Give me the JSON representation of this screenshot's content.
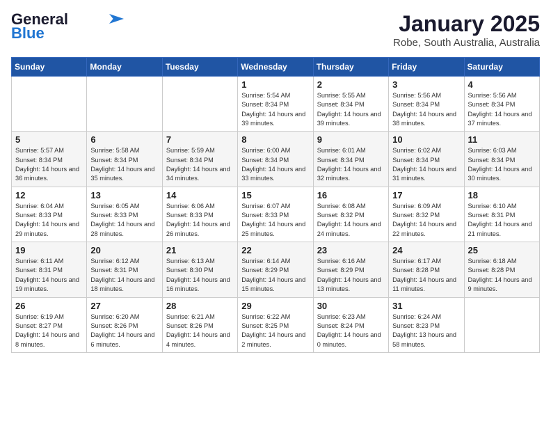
{
  "logo": {
    "line1": "General",
    "line2": "Blue"
  },
  "title": "January 2025",
  "subtitle": "Robe, South Australia, Australia",
  "days_of_week": [
    "Sunday",
    "Monday",
    "Tuesday",
    "Wednesday",
    "Thursday",
    "Friday",
    "Saturday"
  ],
  "weeks": [
    [
      null,
      null,
      null,
      {
        "day": 1,
        "sunrise": "5:54 AM",
        "sunset": "8:34 PM",
        "daylight": "14 hours and 39 minutes."
      },
      {
        "day": 2,
        "sunrise": "5:55 AM",
        "sunset": "8:34 PM",
        "daylight": "14 hours and 39 minutes."
      },
      {
        "day": 3,
        "sunrise": "5:56 AM",
        "sunset": "8:34 PM",
        "daylight": "14 hours and 38 minutes."
      },
      {
        "day": 4,
        "sunrise": "5:56 AM",
        "sunset": "8:34 PM",
        "daylight": "14 hours and 37 minutes."
      }
    ],
    [
      {
        "day": 5,
        "sunrise": "5:57 AM",
        "sunset": "8:34 PM",
        "daylight": "14 hours and 36 minutes."
      },
      {
        "day": 6,
        "sunrise": "5:58 AM",
        "sunset": "8:34 PM",
        "daylight": "14 hours and 35 minutes."
      },
      {
        "day": 7,
        "sunrise": "5:59 AM",
        "sunset": "8:34 PM",
        "daylight": "14 hours and 34 minutes."
      },
      {
        "day": 8,
        "sunrise": "6:00 AM",
        "sunset": "8:34 PM",
        "daylight": "14 hours and 33 minutes."
      },
      {
        "day": 9,
        "sunrise": "6:01 AM",
        "sunset": "8:34 PM",
        "daylight": "14 hours and 32 minutes."
      },
      {
        "day": 10,
        "sunrise": "6:02 AM",
        "sunset": "8:34 PM",
        "daylight": "14 hours and 31 minutes."
      },
      {
        "day": 11,
        "sunrise": "6:03 AM",
        "sunset": "8:34 PM",
        "daylight": "14 hours and 30 minutes."
      }
    ],
    [
      {
        "day": 12,
        "sunrise": "6:04 AM",
        "sunset": "8:33 PM",
        "daylight": "14 hours and 29 minutes."
      },
      {
        "day": 13,
        "sunrise": "6:05 AM",
        "sunset": "8:33 PM",
        "daylight": "14 hours and 28 minutes."
      },
      {
        "day": 14,
        "sunrise": "6:06 AM",
        "sunset": "8:33 PM",
        "daylight": "14 hours and 26 minutes."
      },
      {
        "day": 15,
        "sunrise": "6:07 AM",
        "sunset": "8:33 PM",
        "daylight": "14 hours and 25 minutes."
      },
      {
        "day": 16,
        "sunrise": "6:08 AM",
        "sunset": "8:32 PM",
        "daylight": "14 hours and 24 minutes."
      },
      {
        "day": 17,
        "sunrise": "6:09 AM",
        "sunset": "8:32 PM",
        "daylight": "14 hours and 22 minutes."
      },
      {
        "day": 18,
        "sunrise": "6:10 AM",
        "sunset": "8:31 PM",
        "daylight": "14 hours and 21 minutes."
      }
    ],
    [
      {
        "day": 19,
        "sunrise": "6:11 AM",
        "sunset": "8:31 PM",
        "daylight": "14 hours and 19 minutes."
      },
      {
        "day": 20,
        "sunrise": "6:12 AM",
        "sunset": "8:31 PM",
        "daylight": "14 hours and 18 minutes."
      },
      {
        "day": 21,
        "sunrise": "6:13 AM",
        "sunset": "8:30 PM",
        "daylight": "14 hours and 16 minutes."
      },
      {
        "day": 22,
        "sunrise": "6:14 AM",
        "sunset": "8:29 PM",
        "daylight": "14 hours and 15 minutes."
      },
      {
        "day": 23,
        "sunrise": "6:16 AM",
        "sunset": "8:29 PM",
        "daylight": "14 hours and 13 minutes."
      },
      {
        "day": 24,
        "sunrise": "6:17 AM",
        "sunset": "8:28 PM",
        "daylight": "14 hours and 11 minutes."
      },
      {
        "day": 25,
        "sunrise": "6:18 AM",
        "sunset": "8:28 PM",
        "daylight": "14 hours and 9 minutes."
      }
    ],
    [
      {
        "day": 26,
        "sunrise": "6:19 AM",
        "sunset": "8:27 PM",
        "daylight": "14 hours and 8 minutes."
      },
      {
        "day": 27,
        "sunrise": "6:20 AM",
        "sunset": "8:26 PM",
        "daylight": "14 hours and 6 minutes."
      },
      {
        "day": 28,
        "sunrise": "6:21 AM",
        "sunset": "8:26 PM",
        "daylight": "14 hours and 4 minutes."
      },
      {
        "day": 29,
        "sunrise": "6:22 AM",
        "sunset": "8:25 PM",
        "daylight": "14 hours and 2 minutes."
      },
      {
        "day": 30,
        "sunrise": "6:23 AM",
        "sunset": "8:24 PM",
        "daylight": "14 hours and 0 minutes."
      },
      {
        "day": 31,
        "sunrise": "6:24 AM",
        "sunset": "8:23 PM",
        "daylight": "13 hours and 58 minutes."
      },
      null
    ]
  ]
}
